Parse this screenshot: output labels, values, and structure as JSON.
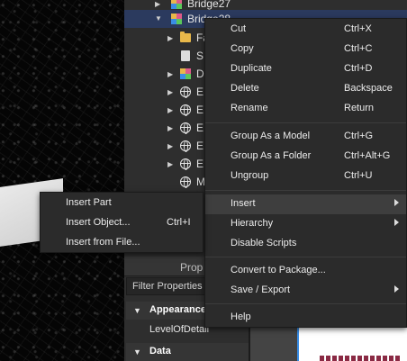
{
  "explorer": {
    "rows": [
      {
        "label": "Bridge27",
        "icon": "model",
        "expanded": false
      },
      {
        "label": "Bridge28",
        "icon": "model",
        "expanded": true,
        "selected": true
      },
      {
        "label": "Fa",
        "icon": "folder"
      },
      {
        "label": "S",
        "icon": "script"
      },
      {
        "label": "D",
        "icon": "model"
      },
      {
        "label": "E",
        "icon": "globe"
      },
      {
        "label": "E",
        "icon": "globe"
      },
      {
        "label": "E",
        "icon": "globe"
      },
      {
        "label": "E",
        "icon": "globe"
      },
      {
        "label": "E",
        "icon": "globe"
      },
      {
        "label": "M",
        "icon": "globe"
      }
    ]
  },
  "properties": {
    "title": "Prop",
    "filter_placeholder": "Filter Properties",
    "sections": [
      {
        "label": "Appearance",
        "rows": [
          "LevelOfDetail"
        ]
      },
      {
        "label": "Data",
        "rows": []
      }
    ]
  },
  "context_menu": {
    "items": [
      {
        "label": "Cut",
        "shortcut": "Ctrl+X"
      },
      {
        "label": "Copy",
        "shortcut": "Ctrl+C"
      },
      {
        "label": "Duplicate",
        "shortcut": "Ctrl+D"
      },
      {
        "label": "Delete",
        "shortcut": "Backspace"
      },
      {
        "label": "Rename",
        "shortcut": "Return"
      },
      {
        "label": "Group As a Model",
        "shortcut": "Ctrl+G"
      },
      {
        "label": "Group As a Folder",
        "shortcut": "Ctrl+Alt+G"
      },
      {
        "label": "Ungroup",
        "shortcut": "Ctrl+U"
      },
      {
        "label": "Insert",
        "submenu": true,
        "highlighted": true
      },
      {
        "label": "Hierarchy",
        "submenu": true
      },
      {
        "label": "Disable Scripts"
      },
      {
        "label": "Convert to Package..."
      },
      {
        "label": "Save / Export",
        "submenu": true
      },
      {
        "label": "Help"
      }
    ]
  },
  "insert_submenu": {
    "items": [
      {
        "label": "Insert Part",
        "shortcut": ""
      },
      {
        "label": "Insert Object...",
        "shortcut": "Ctrl+I"
      },
      {
        "label": "Insert from File...",
        "shortcut": ""
      }
    ]
  },
  "colors": {
    "panel_bg": "#2e2e2e",
    "menu_bg": "#2b2b2b",
    "selected_row": "#2b3a5e",
    "highlight": "#3e3e3e",
    "folder": "#e8b84a",
    "frame_blue": "#3a8ee6"
  }
}
